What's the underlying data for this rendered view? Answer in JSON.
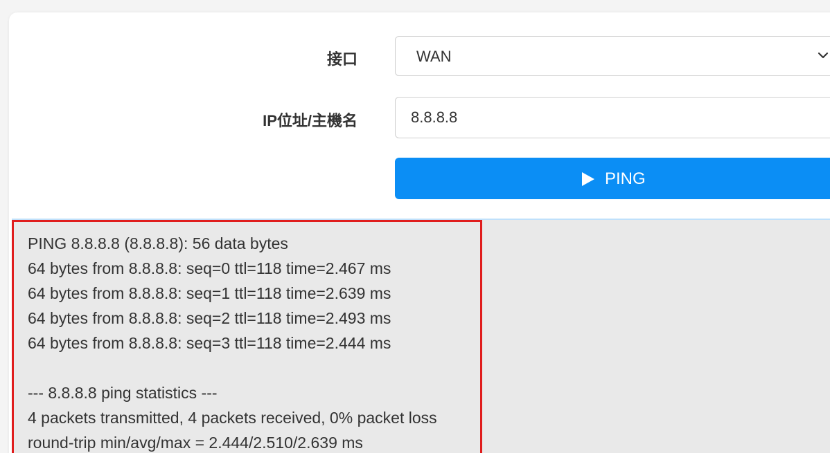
{
  "form": {
    "interface_label": "接口",
    "interface_value": "WAN",
    "host_label": "IP位址/主機名",
    "host_value": "8.8.8.8",
    "ping_button_label": "PING"
  },
  "output": {
    "lines": [
      "PING 8.8.8.8 (8.8.8.8): 56 data bytes",
      "64 bytes from 8.8.8.8: seq=0 ttl=118 time=2.467 ms",
      "64 bytes from 8.8.8.8: seq=1 ttl=118 time=2.639 ms",
      "64 bytes from 8.8.8.8: seq=2 ttl=118 time=2.493 ms",
      "64 bytes from 8.8.8.8: seq=3 ttl=118 time=2.444 ms",
      "",
      "--- 8.8.8.8 ping statistics ---",
      "4 packets transmitted, 4 packets received, 0% packet loss",
      "round-trip min/avg/max = 2.444/2.510/2.639 ms"
    ]
  },
  "icons": {
    "select_chevron": "chevron-down-icon",
    "ping_button": "play-icon"
  },
  "colors": {
    "primary_button": "#0b8ef5",
    "highlight_border": "#e01d1d",
    "output_background": "#e9e9e9"
  }
}
